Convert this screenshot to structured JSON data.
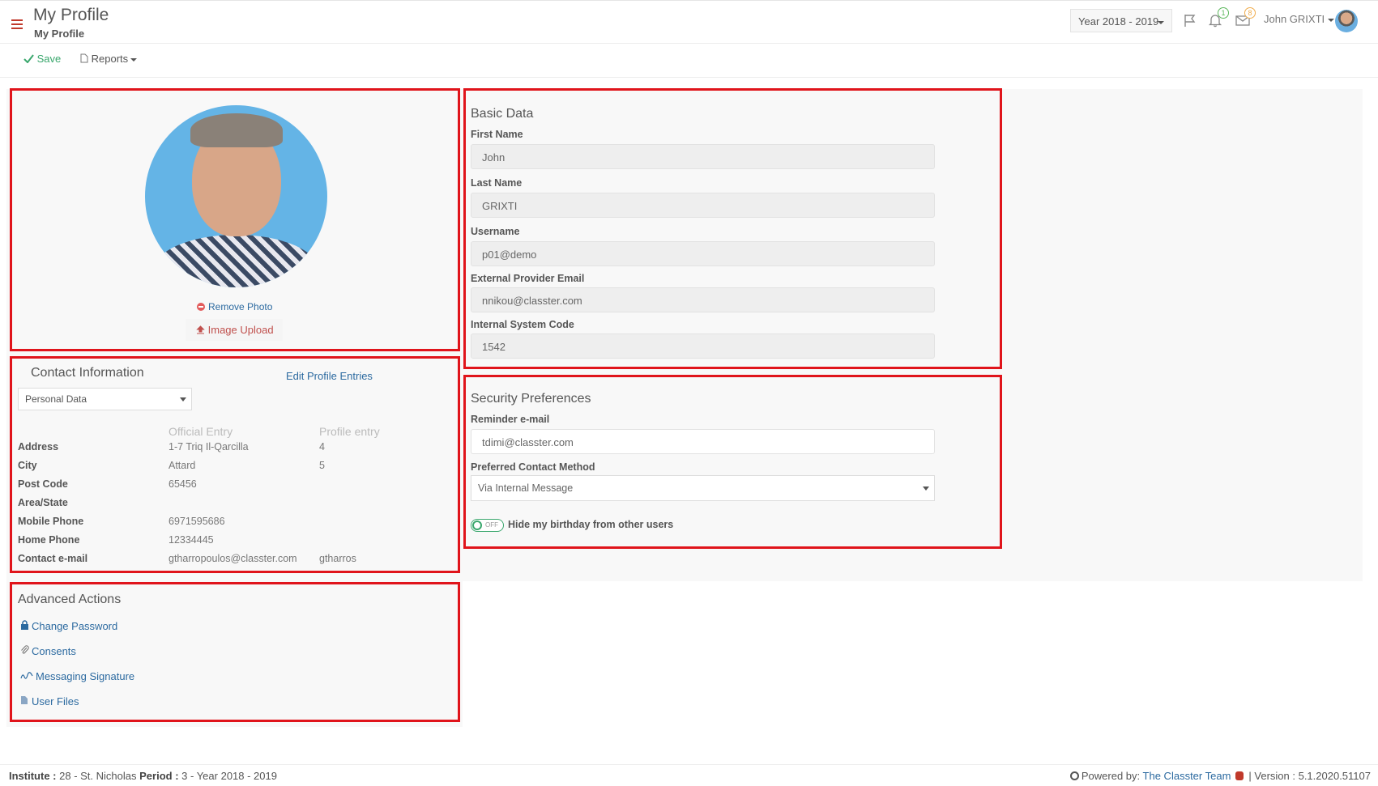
{
  "header": {
    "title": "My Profile",
    "subtitle": "My Profile",
    "year_select": "Year 2018 - 2019",
    "notifications_count": "1",
    "messages_count": "8",
    "user_name": "John GRIXTI"
  },
  "toolbar": {
    "save_label": "Save",
    "reports_label": "Reports"
  },
  "photo_panel": {
    "remove_label": "Remove Photo",
    "upload_label": "Image Upload"
  },
  "contact": {
    "title": "Contact Information",
    "edit_link": "Edit Profile Entries",
    "dropdown_value": "Personal Data",
    "col_official": "Official Entry",
    "col_profile": "Profile entry",
    "rows": [
      {
        "label": "Address",
        "official": "1-7 Triq Il-Qarcilla",
        "profile": "4"
      },
      {
        "label": "City",
        "official": "Attard",
        "profile": "5"
      },
      {
        "label": "Post Code",
        "official": "65456",
        "profile": ""
      },
      {
        "label": "Area/State",
        "official": "",
        "profile": ""
      },
      {
        "label": "Mobile Phone",
        "official": "6971595686",
        "profile": ""
      },
      {
        "label": "Home Phone",
        "official": "12334445",
        "profile": ""
      },
      {
        "label": "Contact e-mail",
        "official": "gtharropoulos@classter.com",
        "profile": "gtharros"
      }
    ]
  },
  "advanced": {
    "title": "Advanced Actions",
    "links": [
      "Change Password",
      "Consents",
      "Messaging Signature",
      "User Files"
    ]
  },
  "basic": {
    "title": "Basic Data",
    "fields": [
      {
        "label": "First Name",
        "value": "John"
      },
      {
        "label": "Last Name",
        "value": "GRIXTI"
      },
      {
        "label": "Username",
        "value": "p01@demo"
      },
      {
        "label": "External Provider Email",
        "value": "nnikou@classter.com"
      },
      {
        "label": "Internal System Code",
        "value": "1542"
      }
    ]
  },
  "security": {
    "title": "Security Preferences",
    "reminder_label": "Reminder e-mail",
    "reminder_value": "tdimi@classter.com",
    "contact_method_label": "Preferred Contact Method",
    "contact_method_value": "Via Internal Message",
    "toggle_state": "OFF",
    "toggle_label": "Hide my birthday from other users"
  },
  "footer": {
    "institute_label": "Institute :",
    "institute_value": "28 - St. Nicholas",
    "period_label": "Period :",
    "period_value": "3 - Year 2018 - 2019",
    "powered_label": "Powered by:",
    "powered_link": "The Classter Team",
    "version": "| Version : 5.1.2020.51107"
  },
  "colors": {
    "accent_red": "#e0141b",
    "link_blue": "#2c6aa0",
    "save_green": "#3aa76d"
  }
}
